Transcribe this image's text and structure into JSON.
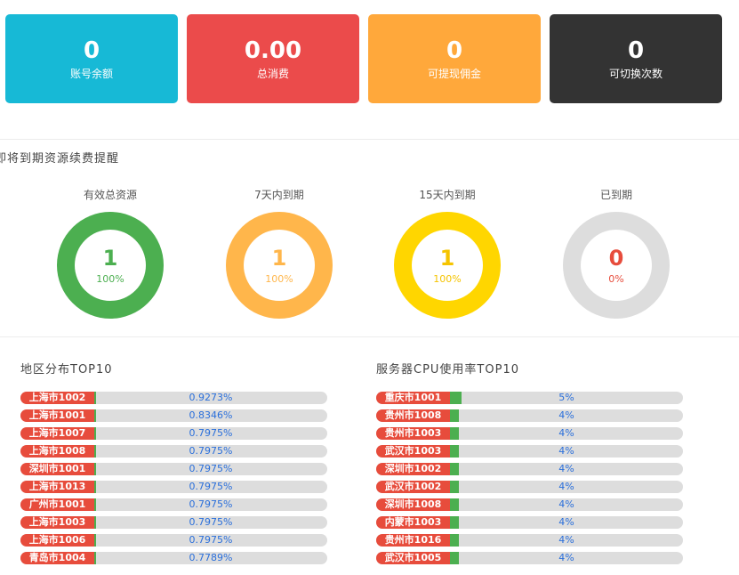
{
  "cards": [
    {
      "value": "0",
      "label": "账号余额",
      "color": "#17b9d6"
    },
    {
      "value": "0.00",
      "label": "总消费",
      "color": "#eb4b4b"
    },
    {
      "value": "0",
      "label": "可提现佣金",
      "color": "#ffa83b"
    },
    {
      "value": "0",
      "label": "可切换次数",
      "color": "#333333"
    }
  ],
  "reminder": {
    "title": "即将到期资源续费提醒",
    "donuts": [
      {
        "label": "有效总资源",
        "value": "1",
        "percent": "100%",
        "fraction": 1.0,
        "color": "#4caf50",
        "text_color": "#4caf50"
      },
      {
        "label": "7天内到期",
        "value": "1",
        "percent": "100%",
        "fraction": 1.0,
        "color": "#ffb64b",
        "text_color": "#ffb64b"
      },
      {
        "label": "15天内到期",
        "value": "1",
        "percent": "100%",
        "fraction": 1.0,
        "color": "#ffd600",
        "text_color": "#f5c400"
      },
      {
        "label": "已到期",
        "value": "0",
        "percent": "0%",
        "fraction": 0.0,
        "color": "#dddddd",
        "text_color": "#e74c3c"
      }
    ]
  },
  "region": {
    "title": "地区分布TOP10",
    "items": [
      {
        "name": "上海市1002",
        "value": "0.9273%",
        "fraction": 0.009273
      },
      {
        "name": "上海市1001",
        "value": "0.8346%",
        "fraction": 0.008346
      },
      {
        "name": "上海市1007",
        "value": "0.7975%",
        "fraction": 0.007975
      },
      {
        "name": "上海市1008",
        "value": "0.7975%",
        "fraction": 0.007975
      },
      {
        "name": "深圳市1001",
        "value": "0.7975%",
        "fraction": 0.007975
      },
      {
        "name": "上海市1013",
        "value": "0.7975%",
        "fraction": 0.007975
      },
      {
        "name": "广州市1001",
        "value": "0.7975%",
        "fraction": 0.007975
      },
      {
        "name": "上海市1003",
        "value": "0.7975%",
        "fraction": 0.007975
      },
      {
        "name": "上海市1006",
        "value": "0.7975%",
        "fraction": 0.007975
      },
      {
        "name": "青岛市1004",
        "value": "0.7789%",
        "fraction": 0.007789
      }
    ]
  },
  "cpu": {
    "title": "服务器CPU使用率TOP10",
    "items": [
      {
        "name": "重庆市1001",
        "value": "5%",
        "fraction": 0.05
      },
      {
        "name": "贵州市1008",
        "value": "4%",
        "fraction": 0.04
      },
      {
        "name": "贵州市1003",
        "value": "4%",
        "fraction": 0.04
      },
      {
        "name": "武汉市1003",
        "value": "4%",
        "fraction": 0.04
      },
      {
        "name": "深圳市1002",
        "value": "4%",
        "fraction": 0.04
      },
      {
        "name": "武汉市1002",
        "value": "4%",
        "fraction": 0.04
      },
      {
        "name": "深圳市1008",
        "value": "4%",
        "fraction": 0.04
      },
      {
        "name": "内蒙市1003",
        "value": "4%",
        "fraction": 0.04
      },
      {
        "name": "贵州市1016",
        "value": "4%",
        "fraction": 0.04
      },
      {
        "name": "武汉市1005",
        "value": "4%",
        "fraction": 0.04
      }
    ]
  }
}
